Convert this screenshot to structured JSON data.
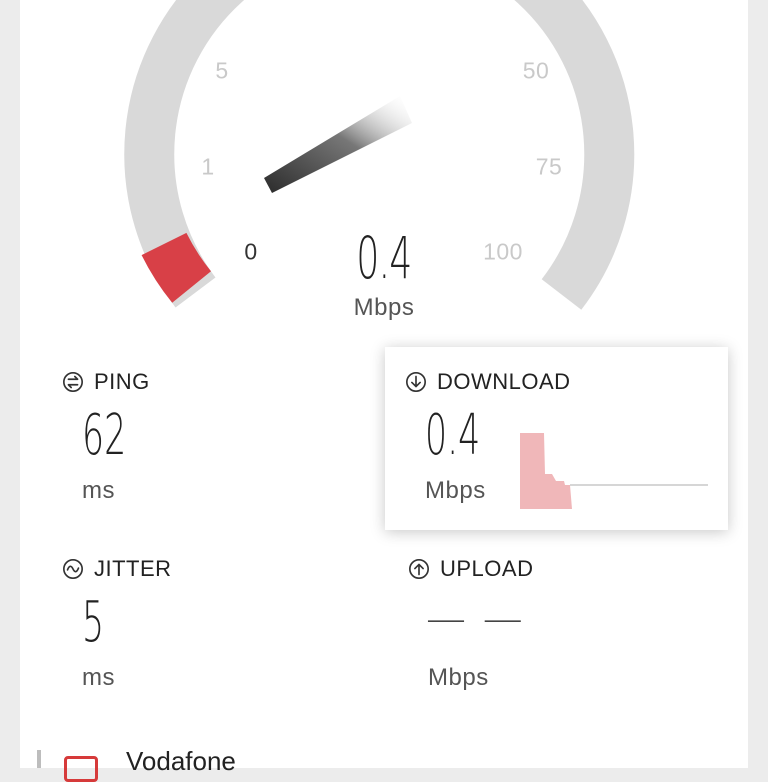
{
  "gauge": {
    "ticks": {
      "t0": "0",
      "t1": "1",
      "t5": "5",
      "t50": "50",
      "t75": "75",
      "t100": "100"
    },
    "value": "0.4",
    "unit": "Mbps",
    "colors": {
      "track": "#d9d9d9",
      "progress": "#d84047",
      "needle_dark": "#2b2b2b"
    }
  },
  "metrics": {
    "ping": {
      "label": "PING",
      "value": "62",
      "unit": "ms",
      "icon": "ping-icon"
    },
    "download": {
      "label": "DOWNLOAD",
      "value": "0.4",
      "unit": "Mbps",
      "icon": "download-arrow-icon",
      "sparkline_color": "#f0b7b9"
    },
    "jitter": {
      "label": "JITTER",
      "value": "5",
      "unit": "ms",
      "icon": "jitter-wave-icon"
    },
    "upload": {
      "label": "UPLOAD",
      "value": "— —",
      "unit": "Mbps",
      "icon": "upload-arrow-icon"
    }
  },
  "provider": {
    "name": "Vodafone",
    "icon": "operator-icon",
    "accent": "#d63a3a"
  }
}
